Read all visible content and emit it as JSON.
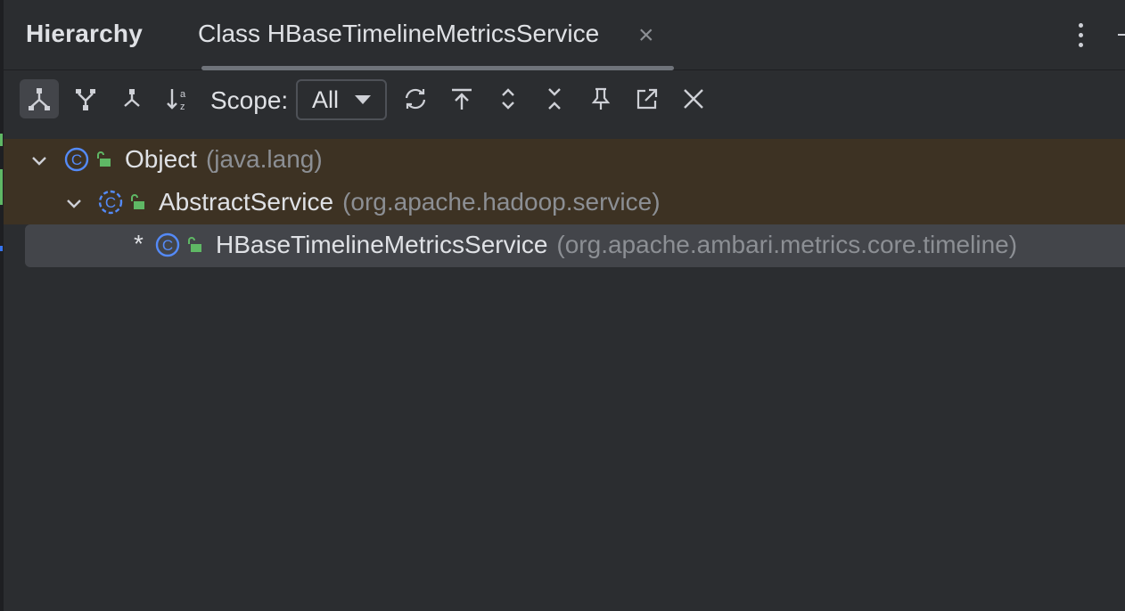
{
  "panel": {
    "title": "Hierarchy"
  },
  "tab": {
    "label": "Class HBaseTimelineMetricsService",
    "close": "×"
  },
  "toolbar": {
    "scope_label": "Scope:",
    "scope_value": "All",
    "buttons": [
      "subtypes-hierarchy-icon",
      "supertypes-hierarchy-icon",
      "class-hierarchy-icon",
      "sort-alphabetically-icon",
      "refresh-icon",
      "base-on-this-class-icon",
      "expand-all-icon",
      "collapse-all-icon",
      "pin-icon",
      "open-in-new-window-icon",
      "close-icon"
    ]
  },
  "tree": {
    "nodes": [
      {
        "name": "Object",
        "package": "(java.lang)",
        "expanded": true,
        "highlighted": true
      },
      {
        "name": "AbstractService",
        "package": "(org.apache.hadoop.service)",
        "expanded": true,
        "highlighted": true
      },
      {
        "marker": "*",
        "name": "HBaseTimelineMetricsService",
        "package": "(org.apache.ambari.metrics.core.timeline)",
        "selected": true
      }
    ]
  },
  "colors": {
    "background": "#2b2d30",
    "highlight_row": "#3d3223",
    "selected_row": "#43454a",
    "class_icon": "#548af7",
    "lock_icon": "#5fb865",
    "package_text": "#8c8f94"
  }
}
